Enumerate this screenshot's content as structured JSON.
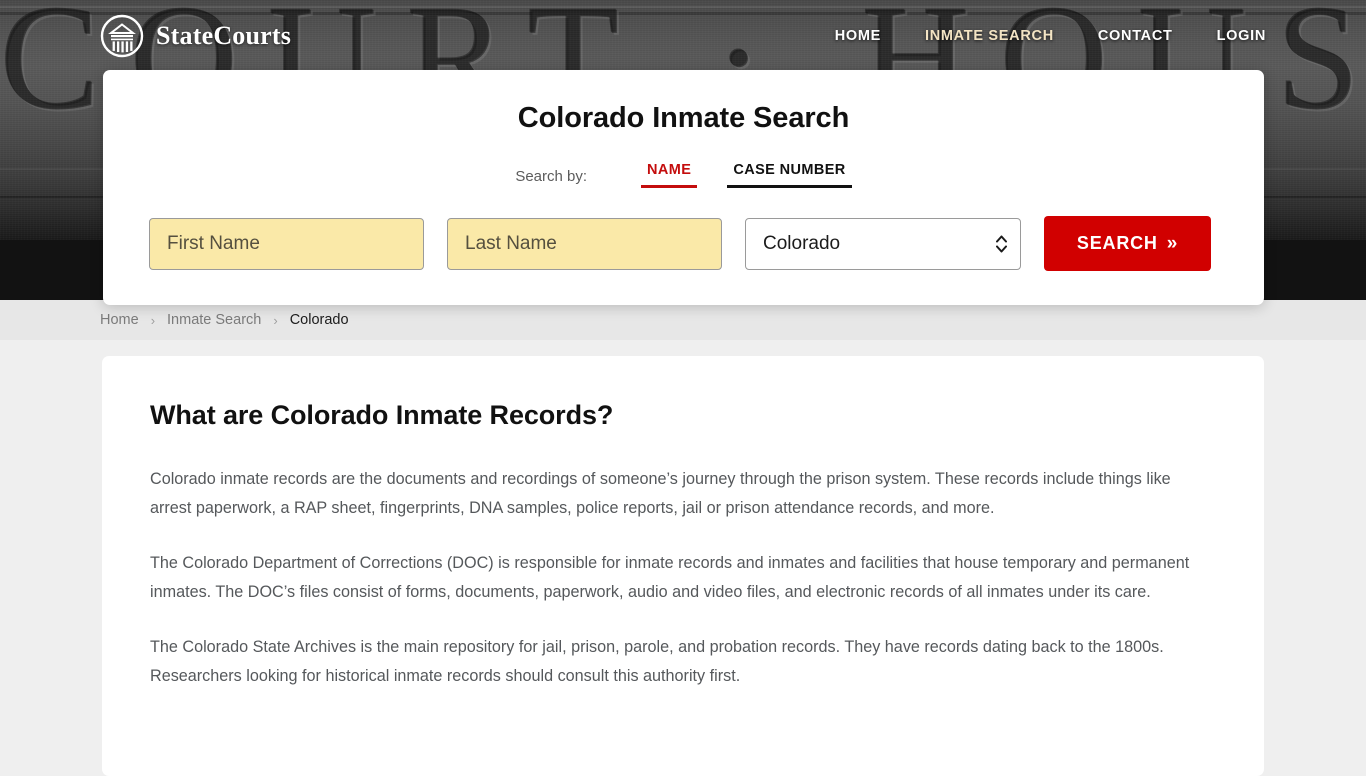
{
  "header": {
    "brand_name": "StateCourts",
    "logo_icon": "courthouse-circle-icon",
    "nav": [
      {
        "label": "HOME",
        "active": false
      },
      {
        "label": "INMATE SEARCH",
        "active": true
      },
      {
        "label": "CONTACT",
        "active": false
      },
      {
        "label": "LOGIN",
        "active": false
      }
    ]
  },
  "hero": {
    "background_text": "COURT · HOUSE",
    "background_style": "grayscale-courthouse-photo"
  },
  "search": {
    "title": "Colorado Inmate Search",
    "search_by_label": "Search by:",
    "tabs": [
      {
        "label": "NAME",
        "active": true,
        "accent": "#c40d0d"
      },
      {
        "label": "CASE NUMBER",
        "active": false,
        "accent": "#111111"
      }
    ],
    "first_name": {
      "value": "",
      "placeholder": "First Name"
    },
    "last_name": {
      "value": "",
      "placeholder": "Last Name"
    },
    "state": {
      "selected": "Colorado",
      "options": [
        "Colorado"
      ]
    },
    "submit_label": "SEARCH",
    "submit_icon": "double-chevron-right-icon",
    "submit_color": "#d10000",
    "autofill_color": "#fae9a8"
  },
  "breadcrumb": {
    "items": [
      {
        "label": "Home",
        "current": false
      },
      {
        "label": "Inmate Search",
        "current": false
      },
      {
        "label": "Colorado",
        "current": true
      }
    ],
    "separator": "›"
  },
  "main": {
    "heading": "What are Colorado Inmate Records?",
    "paragraphs": [
      "Colorado inmate records are the documents and recordings of someone’s journey through the prison system. These records include things like arrest paperwork, a RAP sheet, fingerprints, DNA samples, police reports, jail or prison attendance records, and more.",
      "The Colorado Department of Corrections (DOC) is responsible for inmate records and inmates and facilities that house temporary and permanent inmates. The DOC’s files consist of forms, documents, paperwork, audio and video files, and electronic records of all inmates under its care.",
      "The Colorado State Archives is the main repository for jail, prison, parole, and probation records. They have records dating back to the 1800s. Researchers looking for historical inmate records should consult this authority first."
    ]
  }
}
